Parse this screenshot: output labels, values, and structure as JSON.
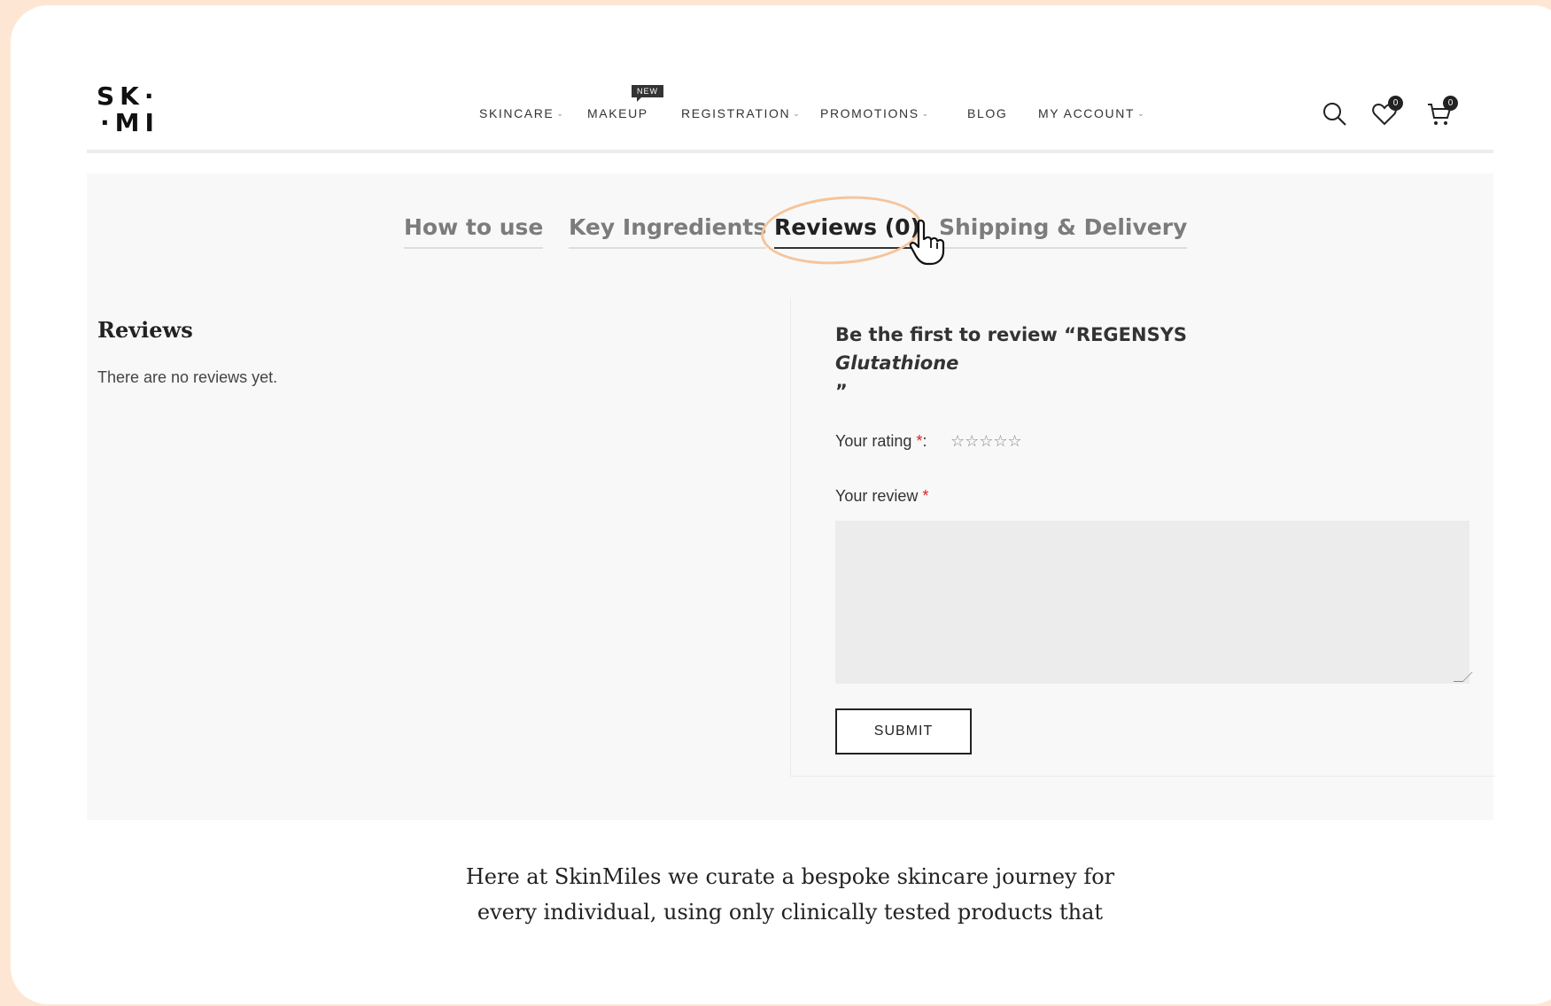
{
  "brand": {
    "logo_line1": "SK·",
    "logo_line2": "·MI"
  },
  "nav": {
    "items": [
      {
        "label": "SKINCARE",
        "has_dropdown": true
      },
      {
        "label": "MAKEUP",
        "has_dropdown": false,
        "badge": "NEW"
      },
      {
        "label": "REGISTRATION",
        "has_dropdown": true
      },
      {
        "label": "PROMOTIONS",
        "has_dropdown": true
      },
      {
        "label": "BLOG",
        "has_dropdown": false
      },
      {
        "label": "MY ACCOUNT",
        "has_dropdown": true
      }
    ]
  },
  "header_icons": {
    "search": "search-icon",
    "wishlist": "heart-icon",
    "wishlist_count": "0",
    "cart": "cart-icon",
    "cart_count": "0"
  },
  "tabs": [
    {
      "label": "How to use",
      "active": false
    },
    {
      "label": "Key Ingredients",
      "active": false
    },
    {
      "label": "Reviews (0)",
      "active": true
    },
    {
      "label": "Shipping & Delivery",
      "active": false
    }
  ],
  "reviews": {
    "title": "Reviews",
    "empty_message": "There are no reviews yet."
  },
  "review_form": {
    "heading_line1": "Be the first to review “REGENSYS",
    "heading_line2": "Glutathione",
    "heading_line3": "”",
    "rating_label": "Your rating",
    "rating_required": "*",
    "rating_colon": ":",
    "stars": "☆☆☆☆☆",
    "review_label": "Your review",
    "review_required": "*",
    "review_value": "",
    "submit_label": "SUBMIT"
  },
  "footer_intro": {
    "line1": "Here at SkinMiles we curate a bespoke skincare journey for",
    "line2": "every individual, using only clinically tested products that"
  },
  "colors": {
    "page_background": "#fde7d4",
    "panel_background": "#f8f8f8",
    "highlight": "#f5c49b",
    "required": "#e02020"
  }
}
